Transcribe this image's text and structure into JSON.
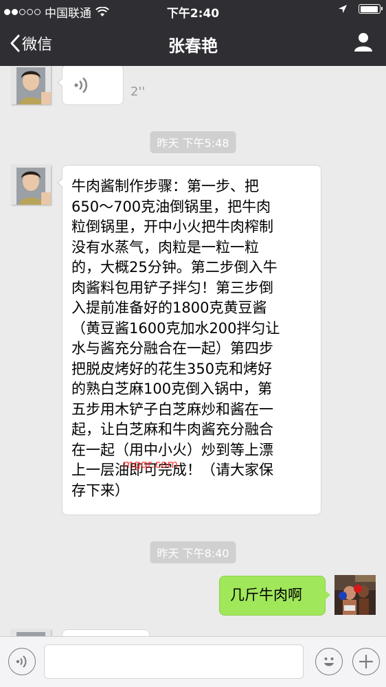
{
  "status_bar": {
    "carrier": "中国联通",
    "time": "下午2:40",
    "signal_bars_filled": 2,
    "signal_bars_total": 5,
    "battery_level": 0.95
  },
  "nav": {
    "back_label": "微信",
    "title": "张春艳"
  },
  "messages": [
    {
      "type": "voice",
      "direction": "in",
      "duration": "2''"
    },
    {
      "type": "timestamp",
      "text": "昨天 下午5:48"
    },
    {
      "type": "text",
      "direction": "in",
      "lines": [
        "牛肉酱制作步骤：第一步、把",
        "650～700克油倒锅里，把牛肉",
        "粒倒锅里，开中小火把牛肉榨制",
        "没有水蒸气，肉粒是一粒一粒",
        "的，大概25分钟。第二步倒入牛",
        "肉酱料包用铲子拌匀！第三步倒",
        "入提前准备好的1800克黄豆酱",
        "（黄豆酱1600克加水200拌匀让",
        "水与酱充分融合在一起）第四步",
        "把脱皮烤好的花生350克和烤好",
        "的熟白芝麻100克倒入锅中，第",
        "五步用木铲子白芝麻炒和酱在一",
        "起，让白芝麻和牛肉酱充分融合",
        "在一起（用中小火）炒到等上漂",
        "上一层油即可完成！（请大家保",
        "存下来）"
      ]
    },
    {
      "type": "timestamp",
      "text": "昨天 下午8:40"
    },
    {
      "type": "text",
      "direction": "out",
      "text": "几斤牛肉啊"
    }
  ],
  "watermark": "mgqr.com",
  "input_bar": {
    "placeholder": "",
    "voice_icon": "voice-toggle-icon",
    "emoji_icon": "emoji-icon",
    "plus_icon": "plus-icon"
  },
  "colors": {
    "nav_bg": "#2e2e33",
    "chat_bg": "#ebebeb",
    "outgoing_bubble": "#a0e75a",
    "incoming_bubble": "#ffffff",
    "timestamp_chip": "#d0d0d0"
  }
}
